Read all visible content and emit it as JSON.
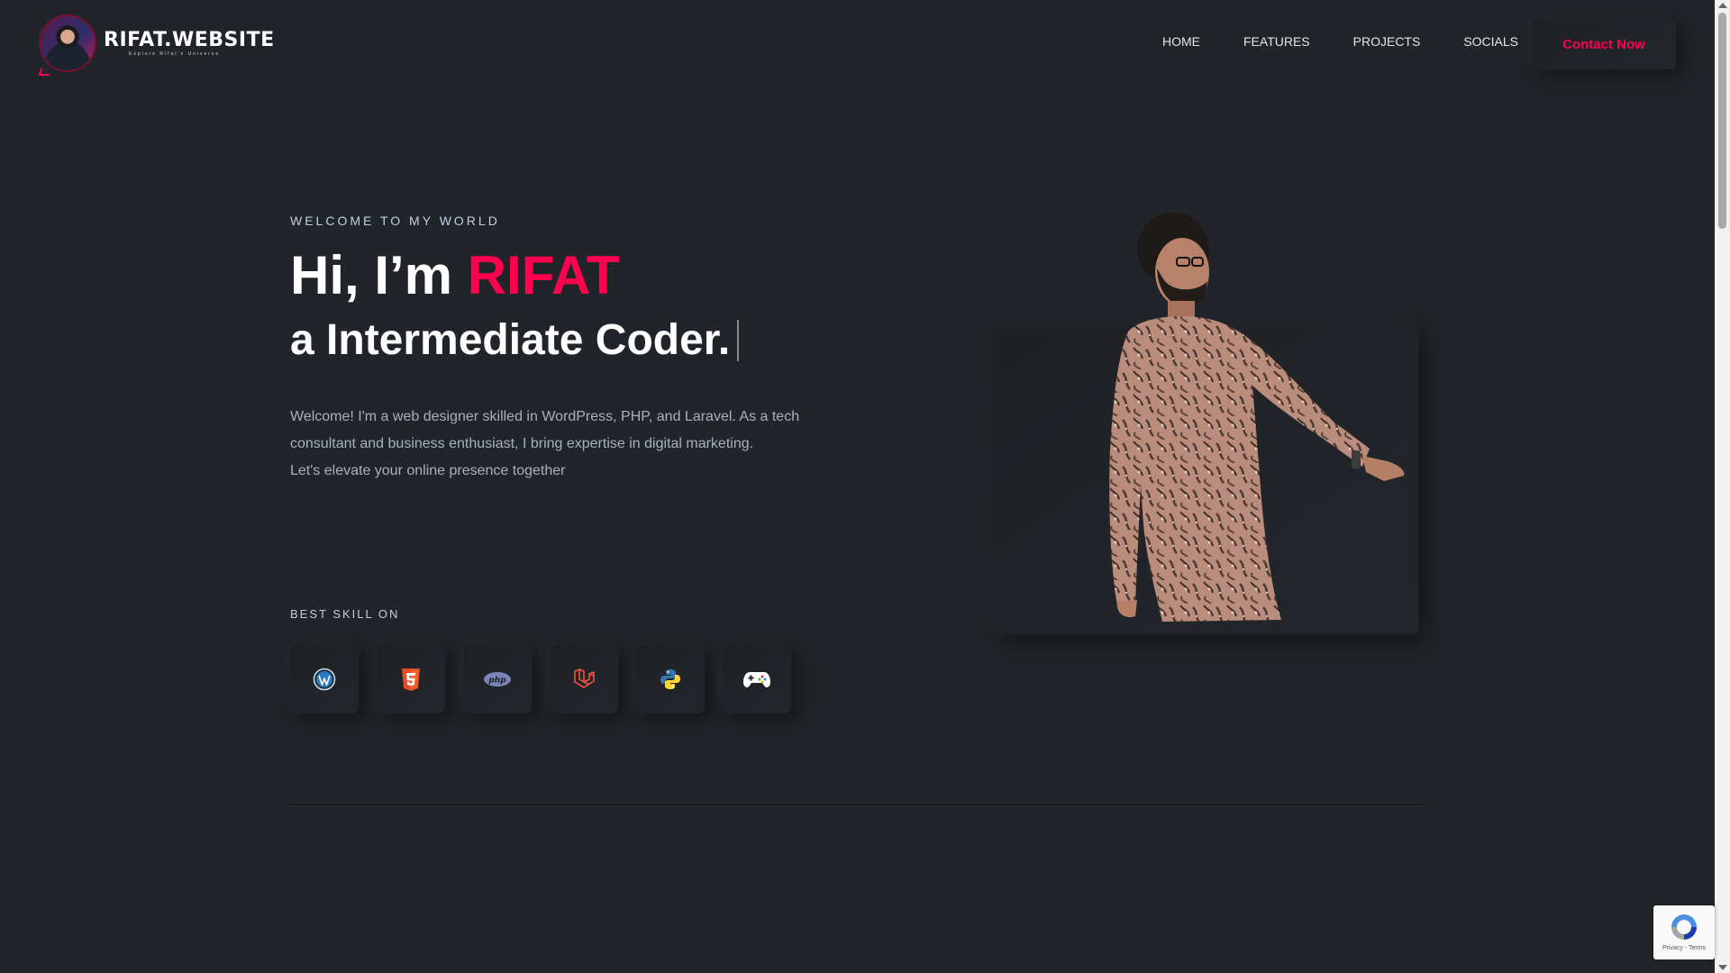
{
  "header": {
    "logo_title": "RIFAT.WEBSITE",
    "logo_subtitle": "Explore Rifat's Universe",
    "nav": [
      "HOME",
      "FEATURES",
      "PROJECTS",
      "SOCIALS"
    ],
    "cta_label": "Contact Now"
  },
  "hero": {
    "welcome": "WELCOME TO MY WORLD",
    "greeting": "Hi, I’m ",
    "name": "RIFAT",
    "subtitle": "a Intermediate Coder.",
    "description_lines": [
      "Welcome! I'm a web designer skilled in WordPress, PHP, and Laravel. As a tech",
      "consultant and business enthusiast, I bring expertise in digital marketing.",
      "Let's elevate your online presence together"
    ],
    "skills_label": "BEST SKILL ON",
    "skills": [
      "wordpress-icon",
      "html5-icon",
      "php-icon",
      "laravel-icon",
      "python-icon",
      "gamepad-icon"
    ]
  },
  "recaptcha": {
    "footer": "Privacy - Terms"
  },
  "colors": {
    "background": "#212428",
    "accent": "#ff014f",
    "text_muted": "#a8b1c0"
  }
}
